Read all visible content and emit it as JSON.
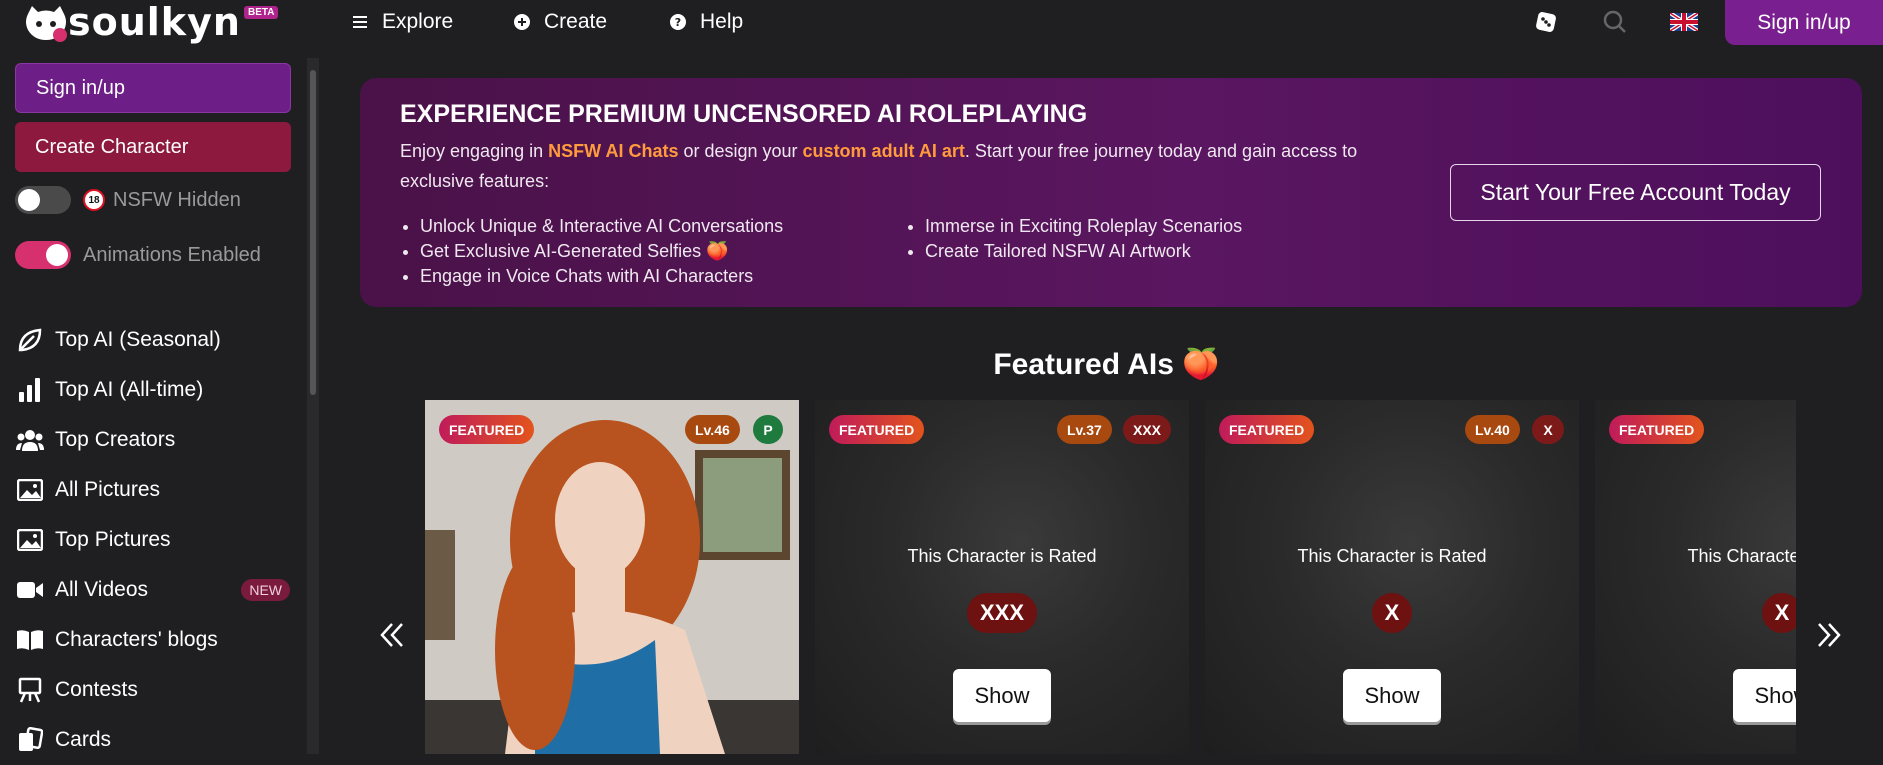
{
  "header": {
    "logo_text": "soulkyn",
    "beta_label": "BETA",
    "nav": [
      {
        "label": "Explore",
        "icon": "list-icon"
      },
      {
        "label": "Create",
        "icon": "plus-circle-icon"
      },
      {
        "label": "Help",
        "icon": "question-circle-icon"
      }
    ],
    "signin_label": "Sign in/up",
    "icons": [
      "dice-icon",
      "search-icon",
      "uk-flag-icon"
    ]
  },
  "sidebar": {
    "signin_label": "Sign in/up",
    "create_label": "Create Character",
    "nsfw_toggle": {
      "label": "NSFW Hidden",
      "badge": "18",
      "on": false
    },
    "animations_toggle": {
      "label": "Animations Enabled",
      "on": true
    },
    "items": [
      {
        "label": "Top AI (Seasonal)",
        "icon": "leaf-icon"
      },
      {
        "label": "Top AI (All-time)",
        "icon": "bar-chart-icon"
      },
      {
        "label": "Top Creators",
        "icon": "users-icon"
      },
      {
        "label": "All Pictures",
        "icon": "image-icon"
      },
      {
        "label": "Top Pictures",
        "icon": "image-icon"
      },
      {
        "label": "All Videos",
        "icon": "video-icon",
        "badge": "NEW"
      },
      {
        "label": "Characters' blogs",
        "icon": "book-icon"
      },
      {
        "label": "Contests",
        "icon": "easel-icon"
      },
      {
        "label": "Cards",
        "icon": "cards-icon"
      }
    ]
  },
  "promo": {
    "title": "EXPERIENCE PREMIUM UNCENSORED AI ROLEPLAYING",
    "desc_part1": "Enjoy engaging in ",
    "desc_hl1": "NSFW AI Chats",
    "desc_part2": " or design your ",
    "desc_hl2": "custom adult AI art",
    "desc_part3": ". Start your free journey today and gain access to exclusive features:",
    "list_left": [
      "Unlock Unique & Interactive AI Conversations",
      "Get Exclusive AI-Generated Selfies 🍑",
      "Engage in Voice Chats with AI Characters"
    ],
    "list_right": [
      "Immerse in Exciting Roleplay Scenarios",
      "Create Tailored NSFW AI Artwork"
    ],
    "cta_label": "Start Your Free Account Today"
  },
  "featured": {
    "title": "Featured AIs 🍑",
    "cards": [
      {
        "featured": "FEATURED",
        "level": "Lv.46",
        "rating": "P",
        "type": "photo"
      },
      {
        "featured": "FEATURED",
        "level": "Lv.37",
        "rating": "XXX",
        "rated_text": "This Character is Rated",
        "show": "Show"
      },
      {
        "featured": "FEATURED",
        "level": "Lv.40",
        "rating": "X",
        "rated_text": "This Character is Rated",
        "show": "Show"
      },
      {
        "featured": "FEATURED",
        "rating": "X",
        "rated_text": "This Character is Rated",
        "show": "Show"
      }
    ]
  }
}
